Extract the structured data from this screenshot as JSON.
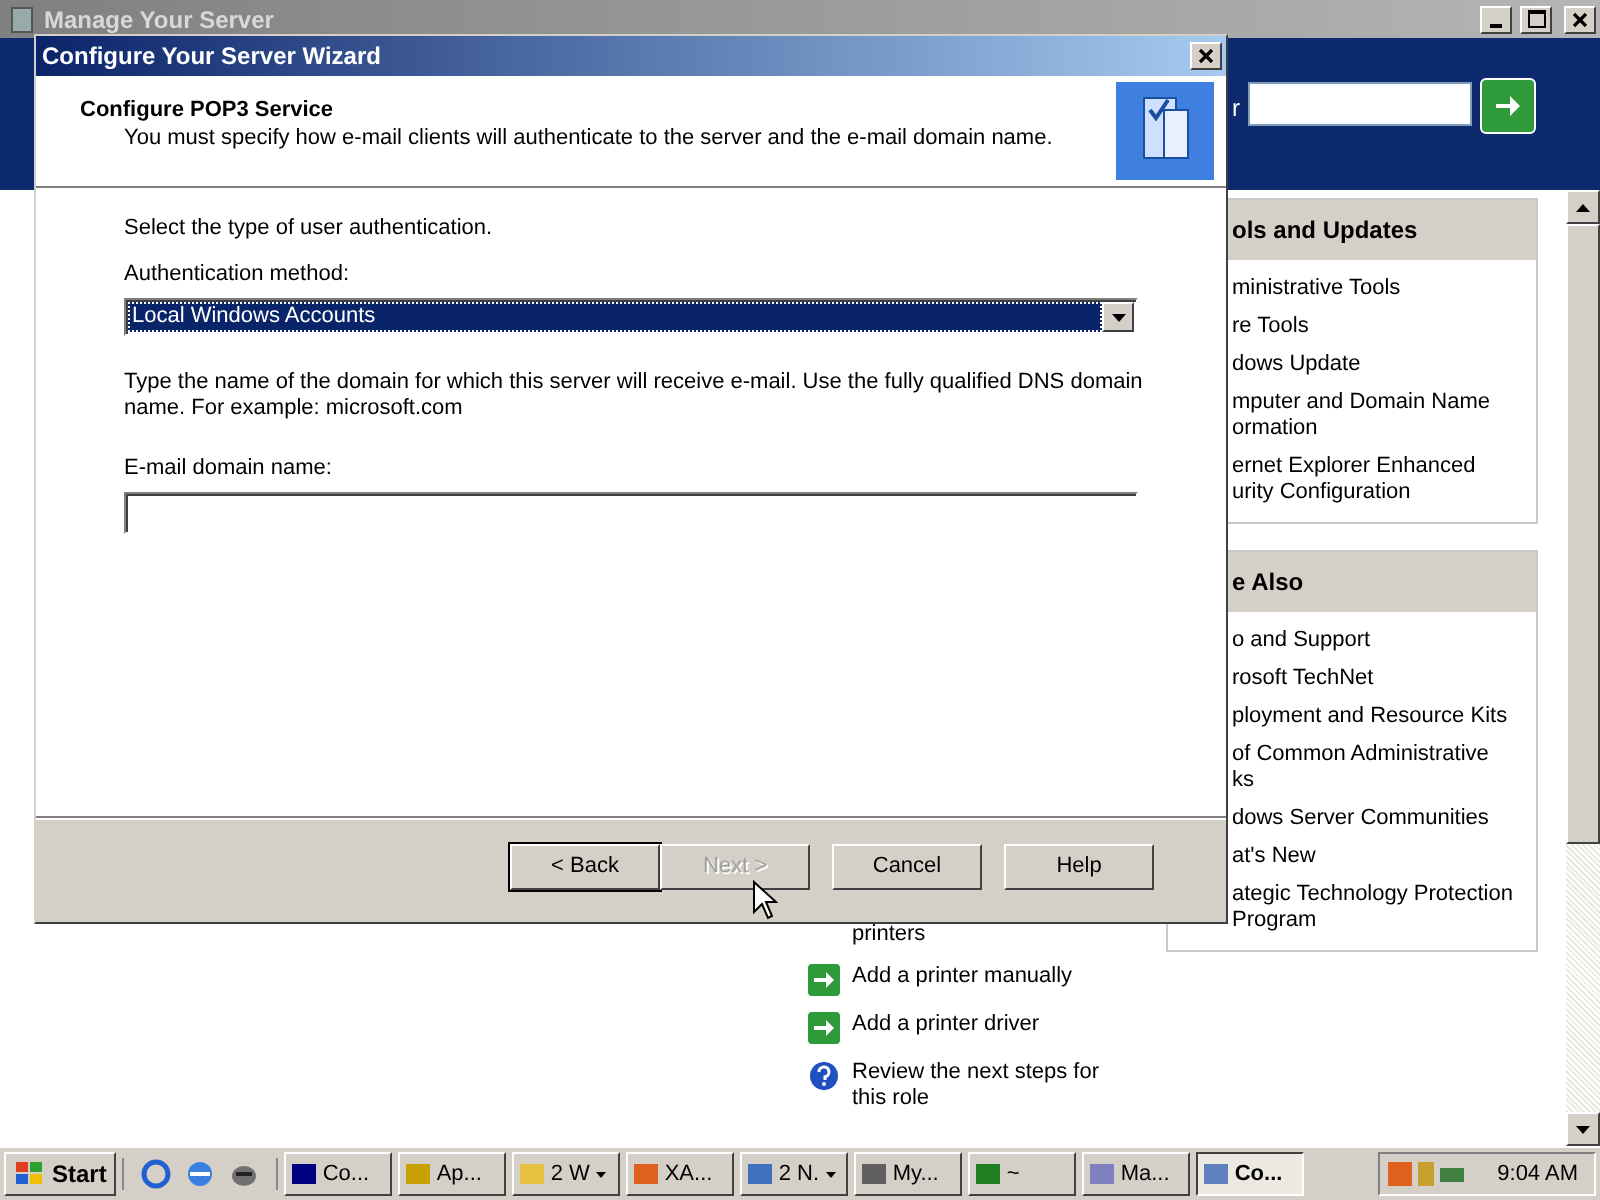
{
  "background_window": {
    "title": "Manage Your Server",
    "search_label": "r",
    "panels": [
      {
        "heading": "ols and Updates",
        "items": [
          {
            "lines": [
              "ministrative Tools"
            ]
          },
          {
            "lines": [
              "re Tools"
            ]
          },
          {
            "lines": [
              "dows Update"
            ]
          },
          {
            "lines": [
              "mputer and Domain Name",
              "ormation"
            ]
          },
          {
            "lines": [
              "ernet Explorer Enhanced",
              "urity Configuration"
            ]
          }
        ]
      },
      {
        "heading": "e Also",
        "items": [
          {
            "lines": [
              "o and Support"
            ]
          },
          {
            "lines": [
              "rosoft TechNet"
            ]
          },
          {
            "lines": [
              "ployment and Resource Kits"
            ]
          },
          {
            "lines": [
              "of Common Administrative",
              "ks"
            ]
          },
          {
            "lines": [
              "dows Server Communities"
            ]
          },
          {
            "lines": [
              "at's New"
            ]
          },
          {
            "lines": [
              "ategic Technology Protection",
              "Program"
            ]
          }
        ]
      }
    ],
    "role_links": [
      {
        "kind": "continuation",
        "text": "printers"
      },
      {
        "kind": "arrow",
        "text": "Add a printer manually"
      },
      {
        "kind": "arrow",
        "text": "Add a printer driver"
      },
      {
        "kind": "help",
        "text": "Review the next steps for this role"
      }
    ]
  },
  "wizard": {
    "title": "Configure Your Server Wizard",
    "heading": "Configure POP3 Service",
    "subtitle": "You must specify how e-mail clients will authenticate to the server and the e-mail domain name.",
    "auth_prompt": "Select the type of user authentication.",
    "auth_label": "Authentication method:",
    "auth_value": "Local Windows Accounts",
    "domain_prompt": "Type the name of the domain for which this server will receive e-mail. Use the fully qualified DNS domain name. For example: microsoft.com",
    "domain_label": "E-mail domain name:",
    "buttons": [
      {
        "label": "< Back",
        "default": true,
        "disabled": false
      },
      {
        "label": "Next >",
        "default": false,
        "disabled": true
      },
      {
        "label": "Cancel",
        "default": false,
        "disabled": false
      },
      {
        "label": "Help",
        "default": false,
        "disabled": false
      }
    ]
  },
  "taskbar": {
    "start": "Start",
    "tasks": [
      {
        "label": "Co...",
        "grouped": false,
        "selected": false
      },
      {
        "label": "Ap...",
        "grouped": false,
        "selected": false
      },
      {
        "label": "2 W",
        "grouped": true,
        "selected": false
      },
      {
        "label": "XA...",
        "grouped": false,
        "selected": false
      },
      {
        "label": "2 N.",
        "grouped": true,
        "selected": false
      },
      {
        "label": "My...",
        "grouped": false,
        "selected": false
      },
      {
        "label": "~",
        "grouped": false,
        "selected": false
      },
      {
        "label": "Ma...",
        "grouped": false,
        "selected": false
      },
      {
        "label": "Co...",
        "grouped": false,
        "selected": true
      }
    ],
    "clock": "9:04 AM"
  }
}
